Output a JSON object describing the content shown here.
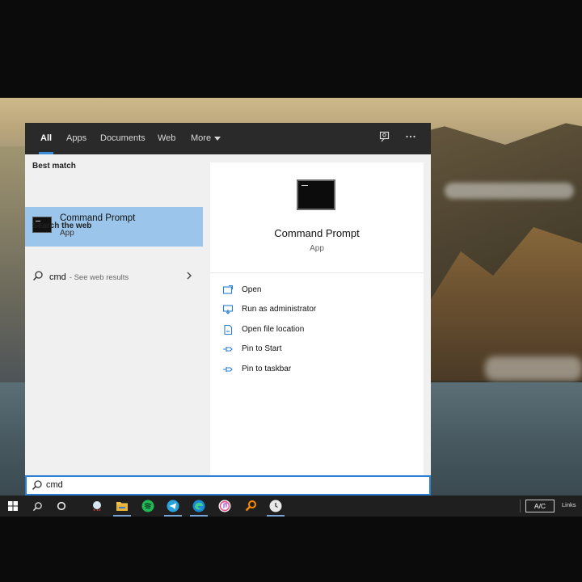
{
  "tabs": [
    {
      "label": "All"
    },
    {
      "label": "Apps"
    },
    {
      "label": "Documents"
    },
    {
      "label": "Web"
    },
    {
      "label": "More"
    }
  ],
  "best_match": {
    "section_title": "Best match",
    "name": "Command Prompt",
    "type": "App"
  },
  "web": {
    "section_title": "Search the web",
    "query": "cmd",
    "hint": "- See web results"
  },
  "preview": {
    "title": "Command Prompt",
    "subtitle": "App",
    "actions": [
      {
        "label": "Open",
        "icon": "open-icon"
      },
      {
        "label": "Run as administrator",
        "icon": "shield-run-icon"
      },
      {
        "label": "Open file location",
        "icon": "file-location-icon"
      },
      {
        "label": "Pin to Start",
        "icon": "pin-icon"
      },
      {
        "label": "Pin to taskbar",
        "icon": "pin-icon"
      }
    ]
  },
  "search": {
    "value": "cmd"
  },
  "taskbar": {
    "apps": [
      "start-icon",
      "search-icon",
      "cortana-icon",
      "weather-icon",
      "file-explorer-icon",
      "spotify-icon",
      "telegram-icon",
      "edge-icon",
      "itunes-icon",
      "search-app-icon",
      "clock-app-icon"
    ],
    "tray_label": "A/C",
    "links_label": "Links"
  },
  "colors": {
    "accent": "#2b7fd0",
    "selection": "#9bc5ea",
    "tabbar": "#2a2a2a",
    "taskbar": "#1f1f1f"
  }
}
